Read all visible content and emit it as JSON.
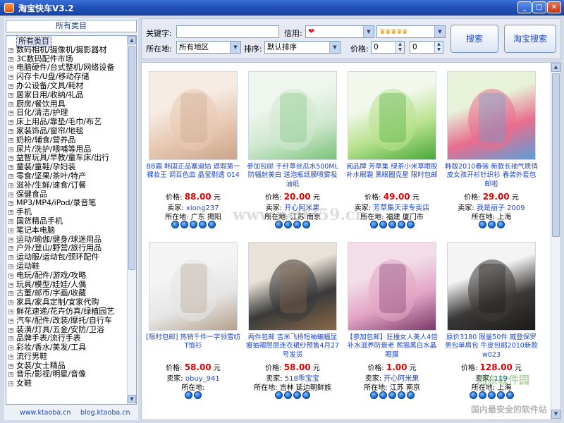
{
  "window": {
    "title": "淘宝快车V3.2",
    "min": "_",
    "max": "□",
    "close": "✕"
  },
  "sidebar": {
    "header": "所有类目",
    "items": [
      "所有类目",
      "数码相机/摄像机/摄影器材",
      "3C数码配件市场",
      "电脑硬件/台式整机/网络设备",
      "闪存卡/U盘/移动存储",
      "办公设备/文具/耗材",
      "居家日用/收纳/礼品",
      "厨房/餐饮用具",
      "日化/清洁/护理",
      "床上用品/靠垫/毛巾/布艺",
      "家装饰品/窗帘/地毯",
      "奶粉/辅食/营养品",
      "尿片/洗护/喂哺等用品",
      "益智玩具/早教/童车床/出行",
      "童装/童鞋/孕妇装",
      "零食/坚果/茶叶/特产",
      "滋补/生鲜/速食/订餐",
      "保健食品",
      "MP3/MP4/iPod/录音笔",
      "手机",
      "国货精品手机",
      "笔记本电脑",
      "运动/瑜伽/健身/球迷用品",
      "户外/登山/野营/旅行用品",
      "运动服/运动包/颈环配件",
      "运动鞋",
      "电玩/配件/游戏/攻略",
      "玩具/模型/娃娃/人偶",
      "古董/邮币/字画/收藏",
      "家具/家具定制/宜家代购",
      "鲜花速递/花卉仿真/绿植园艺",
      "汽车/配件/改装/摩托/自行车",
      "装潢/灯具/五金/安防/卫浴",
      "品牌手表/流行手表",
      "彩妆/香水/美发/工具",
      "流行男鞋",
      "女装/女士精品",
      "音乐/影视/明星/音像",
      "女鞋"
    ],
    "link_left": "www.ktaoba.cn",
    "link_right": "blog.ktaoba.cn"
  },
  "search": {
    "keyword_label": "关键字:",
    "keyword_value": "",
    "credit_label": "信用:",
    "credit_icon": "heart-icon",
    "location_label": "所在地:",
    "location_value": "所有地区",
    "sort_label": "排序:",
    "sort_value": "默认排序",
    "price_label": "价格:",
    "price_min": "0",
    "price_max": "0",
    "search_button": "搜索",
    "taobao_search_button": "淘宝搜索"
  },
  "products": [
    {
      "title": "BB霜 韩国正品塞迪姑 遮瑕第一 裸妆王 调百色皿 晶莹剔透 014",
      "price_label": "价格:",
      "price": "88.00",
      "unit": "元",
      "seller_label": "卖家:",
      "seller": "xiong237",
      "loc_label": "所在地:",
      "location": "广东 揭阳",
      "stars": 5,
      "colors": [
        "#f6ece4",
        "#e8c9b3",
        "#c9a68a"
      ]
    },
    {
      "title": "参加包邮 千纤草丝瓜水500ML防辐射美白 送泡瓶纸膜喷雾吸油纸",
      "price_label": "价格:",
      "price": "20.00",
      "unit": "元",
      "seller_label": "卖家:",
      "seller": "开心阿米果",
      "loc_label": "所在地:",
      "location": "江苏 南京",
      "stars": 4,
      "colors": [
        "#eef6ee",
        "#cfe8cf",
        "#7bc27b"
      ]
    },
    {
      "title": "阅品牌 芳草集 绿茶小米草眼胶 补水眼霜 黑眼圈克星 限时包邮",
      "price_label": "价格:",
      "price": "49.00",
      "unit": "元",
      "seller_label": "卖家:",
      "seller": "芳草集天津专卖店",
      "loc_label": "所在地:",
      "location": "福建 厦门市",
      "stars": 5,
      "colors": [
        "#f2f8ec",
        "#b9e28f",
        "#49a83a"
      ]
    },
    {
      "title": "韩版2010春装 新款长袖气质俏皮女孩开衫针织衫 春装外套包邮啦",
      "price_label": "价格:",
      "price": "29.00",
      "unit": "元",
      "seller_label": "卖家:",
      "seller": "我是丽子 2009",
      "loc_label": "所在地:",
      "location": "上海",
      "stars": 3,
      "colors": [
        "#e8f2d8",
        "#e86e8e",
        "#5aa0d8"
      ]
    },
    {
      "title": "[限时包邮] 热销千件一字领雪纺T恤衫",
      "price_label": "价格:",
      "price": "58.00",
      "unit": "元",
      "seller_label": "卖家:",
      "seller": "obuy_941",
      "loc_label": "所在地:",
      "location": "",
      "stars": 2,
      "colors": [
        "#f4f4f4",
        "#e6e6e6",
        "#b5a08a"
      ]
    },
    {
      "title": "两件包邮 吉米飞扬短袖蝙蝠显瘦抽褶层层连衣裙纱预售4月27号发货",
      "price_label": "价格:",
      "price": "58.00",
      "unit": "元",
      "seller_label": "卖家:",
      "seller": "518乖宝宝",
      "loc_label": "所在地:",
      "location": "吉林 延边朝鲜族",
      "stars": 4,
      "colors": [
        "#e9e2d8",
        "#3a3a3a",
        "#8a6a4a"
      ]
    },
    {
      "title": "【参加包邮】狂撞女人美人4倍补水滋养防衰老 熊猫黑白水晶眼膜",
      "price_label": "价格:",
      "price": "1.00",
      "unit": "元",
      "seller_label": "卖家:",
      "seller": "开心阿米果",
      "loc_label": "所在地:",
      "location": "江苏 南京",
      "stars": 5,
      "colors": [
        "#f2dde8",
        "#e3a5c5",
        "#7a3a6a"
      ]
    },
    {
      "title": "原价3180 限量50件 威登保罗 男包单肩包 牛皮包邮2010新款w023",
      "price_label": "价格:",
      "price": "128.00",
      "unit": "元",
      "seller_label": "卖家:",
      "seller": "119",
      "loc_label": "所在地:",
      "location": "上海",
      "stars": 5,
      "colors": [
        "#f4f4f4",
        "#3c3a38",
        "#1b1a19"
      ]
    }
  ],
  "watermarks": [
    "www.pc0359.cn",
    "河东软件园",
    "国内最安全的软件站"
  ]
}
